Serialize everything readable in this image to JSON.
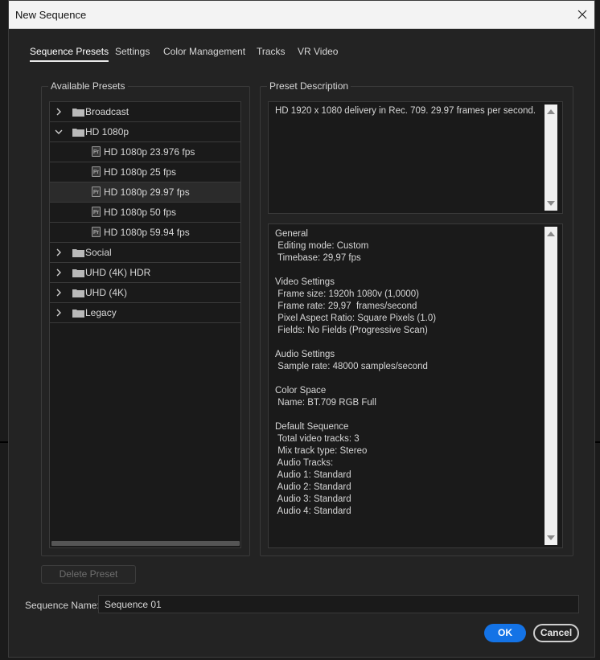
{
  "window": {
    "title": "New Sequence"
  },
  "tabs": [
    {
      "label": "Sequence Presets",
      "active": true
    },
    {
      "label": "Settings",
      "active": false
    },
    {
      "label": "Color Management",
      "active": false
    },
    {
      "label": "Tracks",
      "active": false
    },
    {
      "label": "VR Video",
      "active": false
    }
  ],
  "available_presets": {
    "label": "Available Presets",
    "items": [
      {
        "label": "Broadcast",
        "type": "folder",
        "expanded": false
      },
      {
        "label": "HD 1080p",
        "type": "folder",
        "expanded": true
      },
      {
        "label": "HD 1080p 23.976 fps",
        "type": "preset",
        "badge": "Pr"
      },
      {
        "label": "HD 1080p 25 fps",
        "type": "preset",
        "badge": "Pr"
      },
      {
        "label": "HD 1080p 29.97 fps",
        "type": "preset",
        "badge": "Pr",
        "selected": true
      },
      {
        "label": "HD 1080p 50 fps",
        "type": "preset",
        "badge": "Pr"
      },
      {
        "label": "HD 1080p 59.94 fps",
        "type": "preset",
        "badge": "Pr"
      },
      {
        "label": "Social",
        "type": "folder",
        "expanded": false
      },
      {
        "label": "UHD (4K) HDR",
        "type": "folder",
        "expanded": false
      },
      {
        "label": "UHD (4K)",
        "type": "folder",
        "expanded": false
      },
      {
        "label": "Legacy",
        "type": "folder",
        "expanded": false
      }
    ]
  },
  "preset_description": {
    "label": "Preset Description",
    "description": "HD 1920 x 1080 delivery in Rec. 709. 29.97 frames per second.",
    "info_lines": [
      "General",
      " Editing mode: Custom",
      " Timebase: 29,97 fps",
      "",
      "Video Settings",
      " Frame size: 1920h 1080v (1,0000)",
      " Frame rate: 29,97  frames/second",
      " Pixel Aspect Ratio: Square Pixels (1.0)",
      " Fields: No Fields (Progressive Scan)",
      "",
      "Audio Settings",
      " Sample rate: 48000 samples/second",
      "",
      "Color Space",
      " Name: BT.709 RGB Full",
      "",
      "Default Sequence",
      " Total video tracks: 3",
      " Mix track type: Stereo",
      " Audio Tracks:",
      " Audio 1: Standard",
      " Audio 2: Standard",
      " Audio 3: Standard",
      " Audio 4: Standard"
    ]
  },
  "buttons": {
    "delete_preset": "Delete Preset",
    "ok": "OK",
    "cancel": "Cancel"
  },
  "sequence_name": {
    "label": "Sequence Name:",
    "value": "Sequence 01"
  },
  "colors": {
    "accent": "#1473e6",
    "background": "#232323"
  }
}
